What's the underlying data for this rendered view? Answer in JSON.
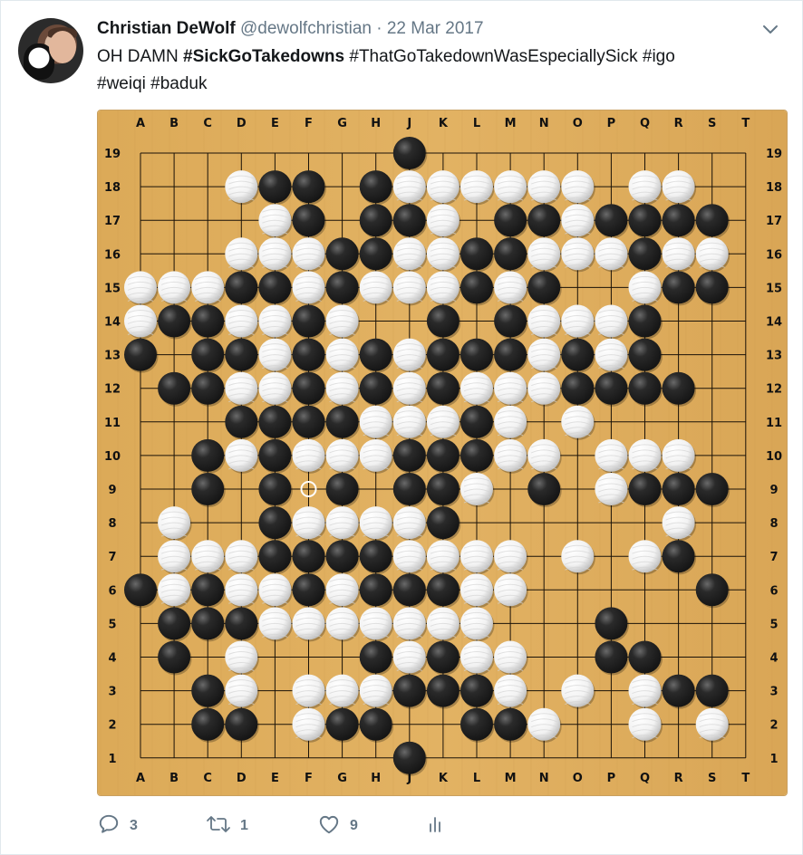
{
  "tweet": {
    "author_name": "Christian DeWolf",
    "handle": "@dewolfchristian",
    "separator": "·",
    "date": "22 Mar 2017",
    "text_line1_pre": "OH DAMN ",
    "text_line1_bold": "#SickGoTakedowns",
    "text_line1_post": " #ThatGoTakedownWasEspeciallySick #igo",
    "text_line2": "#weiqi #baduk"
  },
  "actions": {
    "reply_count": "3",
    "retweet_count": "1",
    "like_count": "9"
  },
  "colors": {
    "board_wood": "#e2b263",
    "grid_line": "#1a1208",
    "black_stone": "#151515",
    "white_stone": "#f2f2f2",
    "icon_gray": "#657786"
  },
  "icons": [
    "chevron-down-icon",
    "reply-icon",
    "retweet-icon",
    "like-icon",
    "analytics-icon"
  ],
  "board": {
    "size": 19,
    "columns": [
      "A",
      "B",
      "C",
      "D",
      "E",
      "F",
      "G",
      "H",
      "J",
      "K",
      "L",
      "M",
      "N",
      "O",
      "P",
      "Q",
      "R",
      "S",
      "T"
    ],
    "rows_top_to_bottom": [
      "19",
      "18",
      "17",
      "16",
      "15",
      "14",
      "13",
      "12",
      "11",
      "10",
      "9",
      "8",
      "7",
      "6",
      "5",
      "4",
      "3",
      "2",
      "1"
    ],
    "last_move": "F9",
    "stones_rows_top_to_bottom": [
      "........b..........",
      "...wbb.bwwwwww.ww..",
      "....wb.bbw.bbwbbbb.",
      "...wwwbbwwbbwwwbww.",
      "wwwbbwbwwwbwb..wbb.",
      "wbbwwbw..b.bwwwb...",
      "b.bbwbwbwbbbwbwb...",
      ".bbwwbwbwbwwwbbbb..",
      "...bbbbwwwbw.w.....",
      "..bwbwwwbbbww.www..",
      "..b.b.b.bbw.b.wbbb.",
      ".w..bwwwwb......w..",
      ".wwwbbbbwwww.w.wb..",
      "bwbwwbwbbbww.....b.",
      ".bbbwwwwwww...b....",
      ".b.w...bwbww..bb...",
      "..bw.wwwbbbw.w.wbb.",
      "..bb.wbb..bbw..w.w.",
      "........b.........."
    ]
  }
}
